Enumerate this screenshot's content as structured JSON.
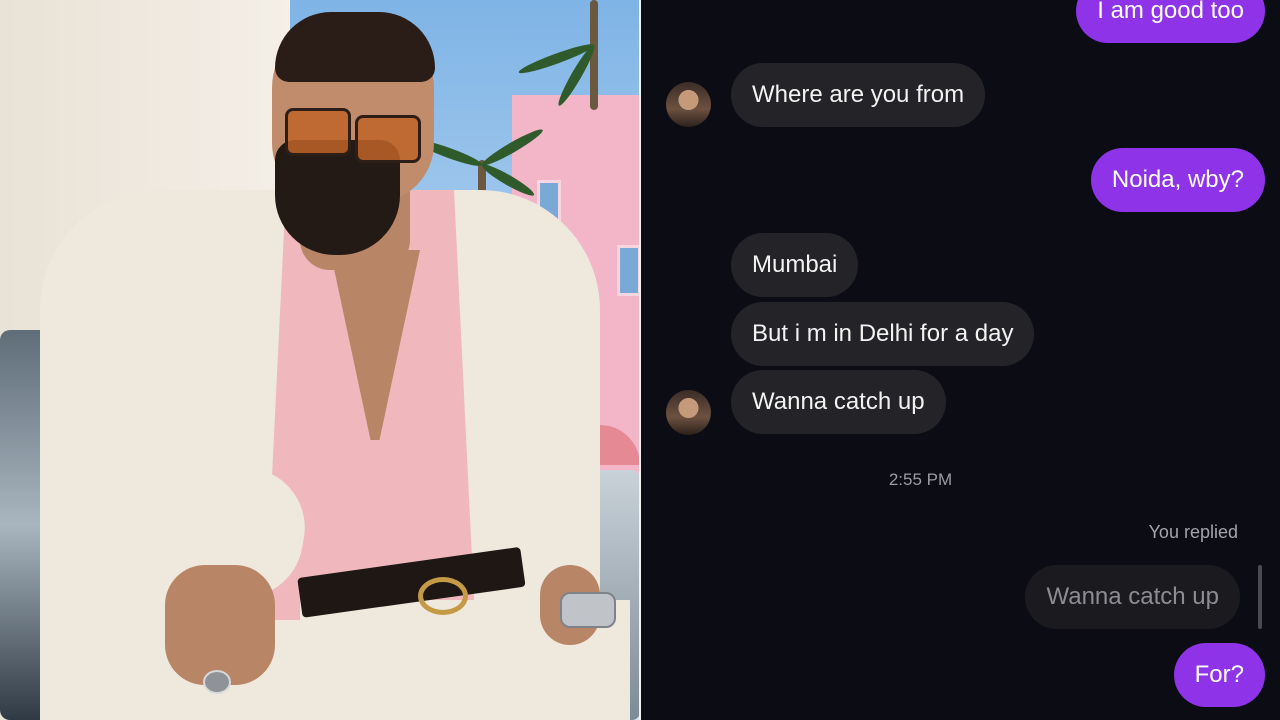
{
  "chat": {
    "messages": [
      {
        "text": "I am good too"
      },
      {
        "text": "Where are you from"
      },
      {
        "text": "Noida, wby?"
      },
      {
        "text": "Mumbai"
      },
      {
        "text": "But i m in Delhi for a day"
      },
      {
        "text": "Wanna catch up"
      },
      {
        "text": "For?"
      }
    ],
    "timestamp": "2:55 PM",
    "replied_label": "You replied",
    "reply_quote": "Wanna catch up"
  },
  "colors": {
    "chat_background": "#0c0c14",
    "incoming_bubble": "#242428",
    "outgoing_bubble": "#8e33e8"
  }
}
